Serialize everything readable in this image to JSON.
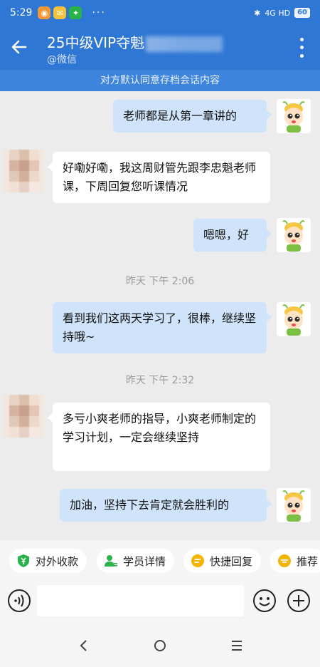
{
  "status_bar": {
    "time": "5:29",
    "more": "···",
    "network": "4G HD",
    "battery": "60"
  },
  "header": {
    "title": "25中级VIP夺魁",
    "subtitle": "@微信"
  },
  "notice": "对方默认同意存档会话内容",
  "messages": [
    {
      "side": "out",
      "text": "老师都是从第一章讲的"
    },
    {
      "side": "in",
      "text": "好嘞好嘞，我这周财管先跟李忠魁老师课，下周回复您听课情况"
    },
    {
      "side": "out",
      "text": "嗯嗯，好"
    },
    {
      "side": "time",
      "text": "昨天  下午 2:06"
    },
    {
      "side": "out",
      "text": "看到我们这两天学习了，很棒，继续坚持哦~"
    },
    {
      "side": "time",
      "text": "昨天  下午 2:32"
    },
    {
      "side": "in",
      "text": "多亏小爽老师的指导，小爽老师制定的学习计划，一定会继续坚持"
    },
    {
      "side": "out",
      "text": "加油，坚持下去肯定就会胜利的"
    }
  ],
  "quick_actions": [
    {
      "label": "对外收款",
      "icon": "yuan-shield-icon",
      "color": "#2bb24c"
    },
    {
      "label": "学员详情",
      "icon": "user-card-icon",
      "color": "#2bb24c"
    },
    {
      "label": "快捷回复",
      "icon": "quick-reply-icon",
      "color": "#f5b400"
    },
    {
      "label": "推荐",
      "icon": "recommend-icon",
      "color": "#f5b400"
    }
  ],
  "input": {
    "placeholder": "",
    "value": ""
  },
  "colors": {
    "brand_blue": "#2f77d4",
    "bubble_out": "#cfe4fb",
    "bubble_in": "#ffffff"
  }
}
